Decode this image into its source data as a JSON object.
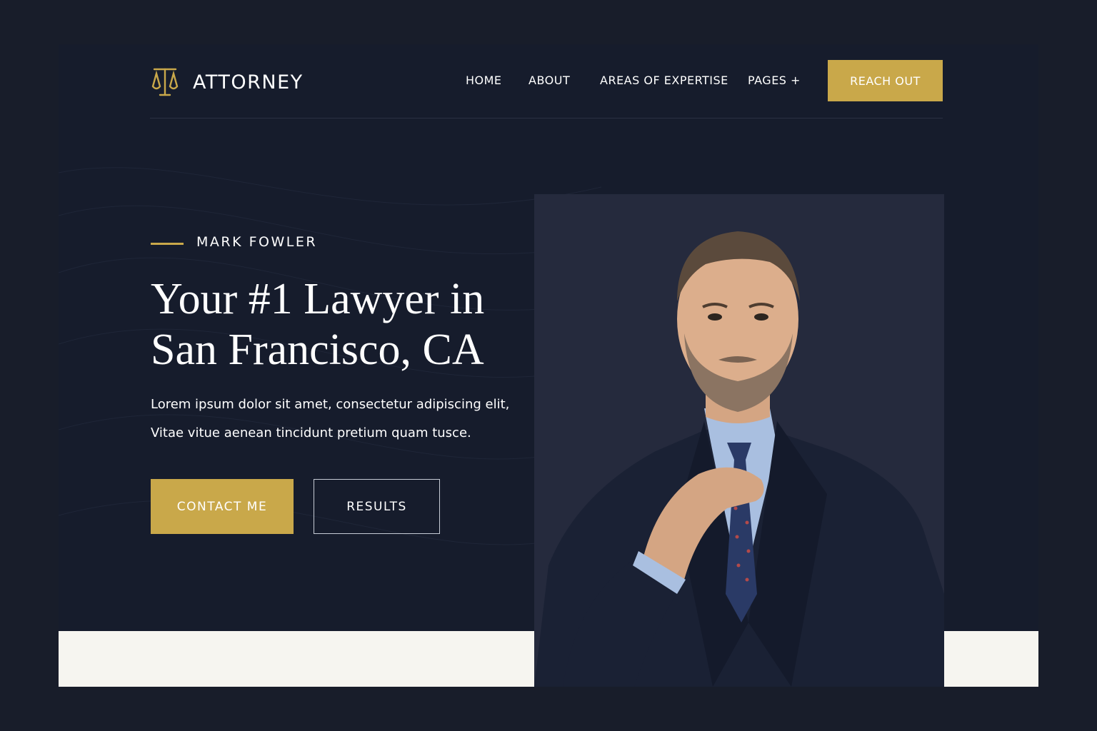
{
  "brand": {
    "name": "ATTORNEY",
    "logo_icon": "scales-of-justice-icon",
    "accent_color": "#c9a84a",
    "background_color": "#161c2c"
  },
  "nav": {
    "home": "HOME",
    "about": "ABOUT",
    "areas": "AREAS OF EXPERTISE",
    "pages": "PAGES +",
    "cta": "REACH OUT"
  },
  "hero": {
    "eyebrow": "MARK FOWLER",
    "headline_line1": "Your #1 Lawyer in",
    "headline_line2": "San Francisco, CA",
    "body_line1": "Lorem ipsum dolor sit amet, consectetur adipiscing elit,",
    "body_line2": "Vitae vitue aenean tincidunt pretium quam tusce.",
    "primary_button": "CONTACT ME",
    "secondary_button": "RESULTS"
  }
}
